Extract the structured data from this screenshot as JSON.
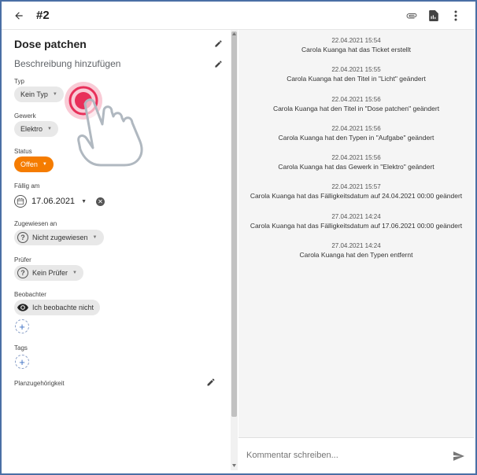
{
  "header": {
    "title": "#2"
  },
  "ticket": {
    "title": "Dose patchen",
    "description_placeholder": "Beschreibung hinzufügen"
  },
  "fields": {
    "type": {
      "label": "Typ",
      "value": "Kein Typ"
    },
    "trade": {
      "label": "Gewerk",
      "value": "Elektro"
    },
    "status": {
      "label": "Status",
      "value": "Offen",
      "color": "#f57c00"
    },
    "due": {
      "label": "Fällig am",
      "value": "17.06.2021"
    },
    "assigned": {
      "label": "Zugewiesen an",
      "value": "Nicht zugewiesen"
    },
    "reviewer": {
      "label": "Prüfer",
      "value": "Kein Prüfer"
    },
    "observer": {
      "label": "Beobachter",
      "value": "Ich beobachte nicht"
    },
    "tags": {
      "label": "Tags"
    },
    "plan": {
      "label": "Planzugehörigkeit"
    }
  },
  "activity": [
    {
      "time": "22.04.2021 15:54",
      "text": "Carola Kuanga hat das Ticket erstellt"
    },
    {
      "time": "22.04.2021 15:55",
      "text": "Carola Kuanga hat den Titel in \"Licht\" geändert"
    },
    {
      "time": "22.04.2021 15:56",
      "text": "Carola Kuanga hat den Titel in \"Dose patchen\" geändert"
    },
    {
      "time": "22.04.2021 15:56",
      "text": "Carola Kuanga hat den Typen in \"Aufgabe\" geändert"
    },
    {
      "time": "22.04.2021 15:56",
      "text": "Carola Kuanga hat das Gewerk in \"Elektro\" geändert"
    },
    {
      "time": "22.04.2021 15:57",
      "text": "Carola Kuanga hat das Fälligkeitsdatum auf 24.04.2021 00:00 geändert"
    },
    {
      "time": "27.04.2021 14:24",
      "text": "Carola Kuanga hat das Fälligkeitsdatum auf 17.06.2021 00:00 geändert"
    },
    {
      "time": "27.04.2021 14:24",
      "text": "Carola Kuanga hat den Typen entfernt"
    }
  ],
  "comment": {
    "placeholder": "Kommentar schreiben..."
  },
  "icons": {
    "back": "arrow-left-icon",
    "attach": "paperclip-icon",
    "pdf": "pdf-file-icon",
    "more": "more-vert-icon",
    "edit": "pencil-icon",
    "calendar": "calendar-clock-icon",
    "clear": "close-circle-icon",
    "question": "question-circle-icon",
    "eye": "eye-icon",
    "add": "plus-icon",
    "send": "send-icon",
    "touch": "tap-gesture-icon"
  },
  "colors": {
    "accent": "#f57c00",
    "frame": "#4a6fa5",
    "touch": "#e8305a"
  }
}
